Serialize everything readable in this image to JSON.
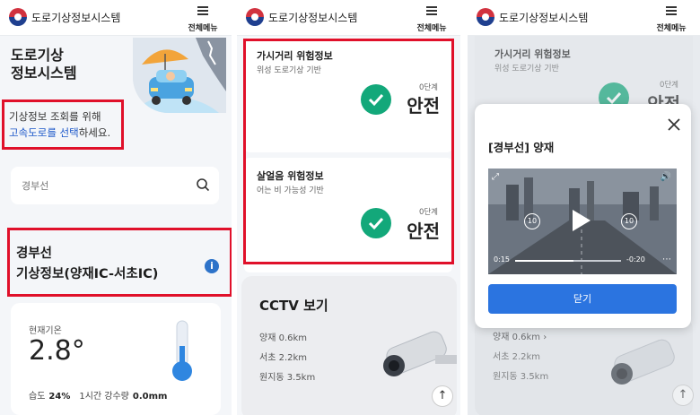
{
  "app": {
    "title": "도로기상정보시스템",
    "menu_label": "전체메뉴"
  },
  "panel1": {
    "hero_line1": "도로기상",
    "hero_line2": "정보시스템",
    "hint_line1": "기상정보 조회를 위해",
    "hint_link": "고속도로를 선택",
    "hint_suffix": "하세요.",
    "search_placeholder": "경부선",
    "route_line1": "경부선",
    "route_line2": "기상정보(양재IC-서초IC)",
    "info_icon_text": "i",
    "weather": {
      "temp_label": "현재기온",
      "temp_value": "2.8°",
      "humidity_label": "습도",
      "humidity_value": "24%",
      "rain_label": "1시간 강수량",
      "rain_value": "0.0mm"
    }
  },
  "panel2": {
    "risk_items": [
      {
        "title": "가시거리 위험정보",
        "subtitle": "위성 도로기상 기반",
        "level": "0단계",
        "status": "안전"
      },
      {
        "title": "살얼음 위험정보",
        "subtitle": "어는 비 가능성 기반",
        "level": "0단계",
        "status": "안전"
      }
    ],
    "cctv_title": "CCTV 보기",
    "cctv_items": [
      "양재 0.6km",
      "서초 2.2km",
      "원지동 3.5km"
    ],
    "up_button": "↑"
  },
  "panel3": {
    "bg_title": "가시거리 위험정보",
    "bg_subtitle": "위성 도로기상 기반",
    "bg_level": "0단계",
    "bg_status": "안전",
    "modal_title": "[경부선] 양재",
    "video_time_current": "0:15",
    "video_time_remaining": "-0:20",
    "video_progress": 0.55,
    "skip_back": "10",
    "skip_forward": "10",
    "close_button": "닫기",
    "cctv_items": [
      "양재 0.6km",
      "서초 2.2km",
      "원지동 3.5km"
    ],
    "up_button": "↑"
  },
  "colors": {
    "highlight_red": "#e0102a",
    "check_green": "#13a87a",
    "link_blue": "#1a56c9",
    "button_blue": "#2b74e0"
  }
}
